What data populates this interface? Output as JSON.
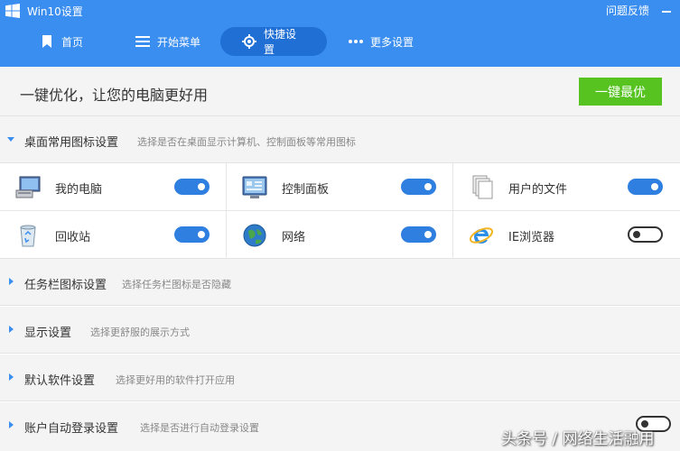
{
  "app": {
    "title": "Win10设置",
    "feedback": "问题反馈",
    "logo_icon": "windows-logo-icon"
  },
  "nav": {
    "home": "首页",
    "start_menu": "开始菜单",
    "quick_settings": "快捷设置",
    "more_settings": "更多设置",
    "active": "快捷设置"
  },
  "topbar": {
    "title": "一键优化，让您的电脑更好用",
    "optimize_button": "一键最优"
  },
  "sections": [
    {
      "title": "桌面常用图标设置",
      "desc": "选择是否在桌面显示计算机、控制面板等常用图标",
      "expanded": true
    },
    {
      "title": "任务栏图标设置",
      "desc": "选择任务栏图标是否隐藏",
      "expanded": false
    },
    {
      "title": "显示设置",
      "desc": "选择更舒服的展示方式",
      "expanded": false
    },
    {
      "title": "默认软件设置",
      "desc": "选择更好用的软件打开应用",
      "expanded": false
    },
    {
      "title": "账户自动登录设置",
      "desc": "选择是否进行自动登录设置",
      "expanded": false
    }
  ],
  "desktop_icons": [
    {
      "label": "我的电脑",
      "icon": "computer-icon",
      "enabled": true
    },
    {
      "label": "控制面板",
      "icon": "control-panel-icon",
      "enabled": true
    },
    {
      "label": "用户的文件",
      "icon": "user-files-icon",
      "enabled": true
    },
    {
      "label": "回收站",
      "icon": "recycle-bin-icon",
      "enabled": true
    },
    {
      "label": "网络",
      "icon": "network-icon",
      "enabled": true
    },
    {
      "label": "IE浏览器",
      "icon": "ie-browser-icon",
      "enabled": false
    }
  ],
  "auto_login_enabled": false,
  "watermark": "头条号 / 网络生活融用",
  "colors": {
    "header": "#3a8ef0",
    "active_nav": "#1f6fd4",
    "optimize": "#56c321",
    "toggle_on": "#2f7fe0"
  }
}
